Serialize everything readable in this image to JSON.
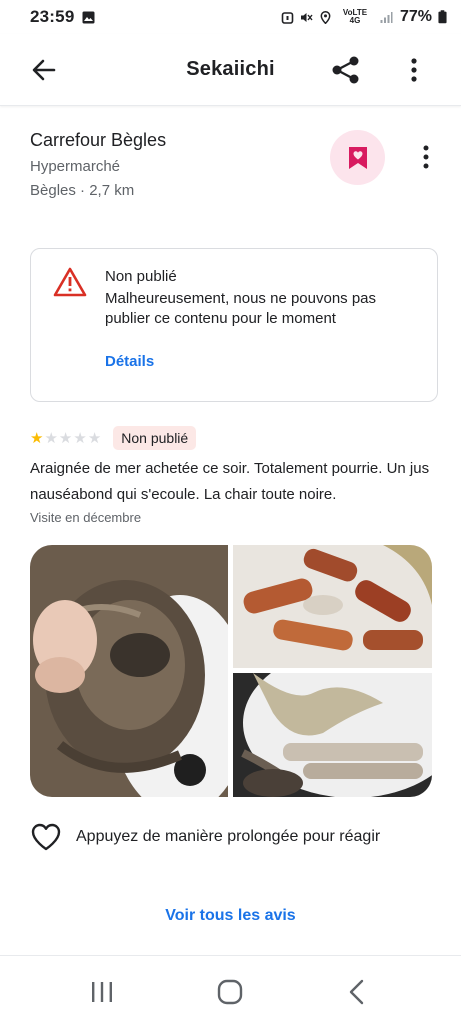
{
  "status_bar": {
    "time": "23:59",
    "network_label": "VoLTE 4G",
    "battery": "77%"
  },
  "app_bar": {
    "title": "Sekaiichi"
  },
  "place": {
    "name": "Carrefour Bègles",
    "type": "Hypermarché",
    "location_distance": "Bègles · 2,7 km"
  },
  "notice": {
    "title": "Non publié",
    "body": "Malheureusement, nous ne pouvons pas publier ce contenu pour le moment",
    "link": "Détails"
  },
  "review": {
    "rating": 1,
    "max_rating": 5,
    "badge": "Non publié",
    "text": "Araignée de mer achetée ce soir. Totalement pourrie. Un jus nauséabond qui s'ecoule. La chair toute noire.",
    "visit": "Visite en décembre"
  },
  "reaction": {
    "label": "Appuyez de manière prolongée pour réagir"
  },
  "footer": {
    "see_all": "Voir tous les avis"
  },
  "colors": {
    "accent": "#1a73e8",
    "save_pink": "#d81b60",
    "warning_red": "#d93025",
    "star": "#fbbc04"
  }
}
